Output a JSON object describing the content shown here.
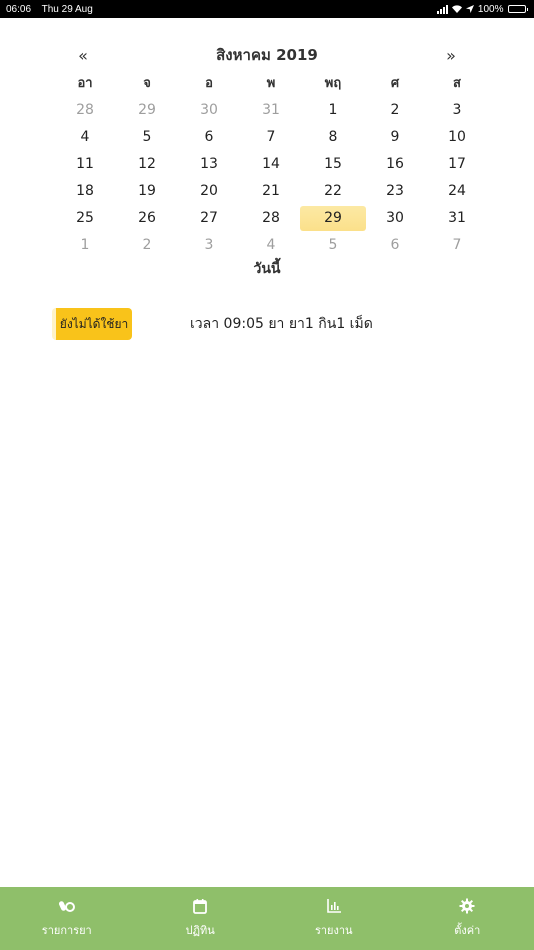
{
  "status_bar": {
    "time": "06:06",
    "date": "Thu 29 Aug",
    "battery": "100%"
  },
  "calendar": {
    "prev": "«",
    "next": "»",
    "title": "สิงหาคม 2019",
    "weekdays": [
      "อา",
      "จ",
      "อ",
      "พ",
      "พฤ",
      "ศ",
      "ส"
    ],
    "weeks": [
      [
        {
          "d": "28",
          "m": true
        },
        {
          "d": "29",
          "m": true
        },
        {
          "d": "30",
          "m": true
        },
        {
          "d": "31",
          "m": true
        },
        {
          "d": "1"
        },
        {
          "d": "2"
        },
        {
          "d": "3"
        }
      ],
      [
        {
          "d": "4"
        },
        {
          "d": "5"
        },
        {
          "d": "6"
        },
        {
          "d": "7"
        },
        {
          "d": "8"
        },
        {
          "d": "9"
        },
        {
          "d": "10"
        }
      ],
      [
        {
          "d": "11"
        },
        {
          "d": "12"
        },
        {
          "d": "13"
        },
        {
          "d": "14"
        },
        {
          "d": "15"
        },
        {
          "d": "16"
        },
        {
          "d": "17"
        }
      ],
      [
        {
          "d": "18"
        },
        {
          "d": "19"
        },
        {
          "d": "20"
        },
        {
          "d": "21"
        },
        {
          "d": "22"
        },
        {
          "d": "23"
        },
        {
          "d": "24"
        }
      ],
      [
        {
          "d": "25"
        },
        {
          "d": "26"
        },
        {
          "d": "27"
        },
        {
          "d": "28"
        },
        {
          "d": "29",
          "t": true
        },
        {
          "d": "30"
        },
        {
          "d": "31"
        }
      ],
      [
        {
          "d": "1",
          "m": true
        },
        {
          "d": "2",
          "m": true
        },
        {
          "d": "3",
          "m": true
        },
        {
          "d": "4",
          "m": true
        },
        {
          "d": "5",
          "m": true
        },
        {
          "d": "6",
          "m": true
        },
        {
          "d": "7",
          "m": true
        }
      ]
    ],
    "today_label": "วันนี้"
  },
  "medication": {
    "status_label": "ยังไม่ได้ใช้ยา",
    "detail": "เวลา 09:05 ยา ยา1 กิน1 เม็ด"
  },
  "tabs": [
    {
      "label": "รายการยา",
      "icon": "pills-icon"
    },
    {
      "label": "ปฏิทิน",
      "icon": "calendar-icon"
    },
    {
      "label": "รายงาน",
      "icon": "chart-icon"
    },
    {
      "label": "ตั้งค่า",
      "icon": "gear-icon"
    }
  ],
  "colors": {
    "accent": "#f9c31a",
    "today_highlight": "#fbe08a",
    "tab_bar": "#8fbf6a"
  }
}
